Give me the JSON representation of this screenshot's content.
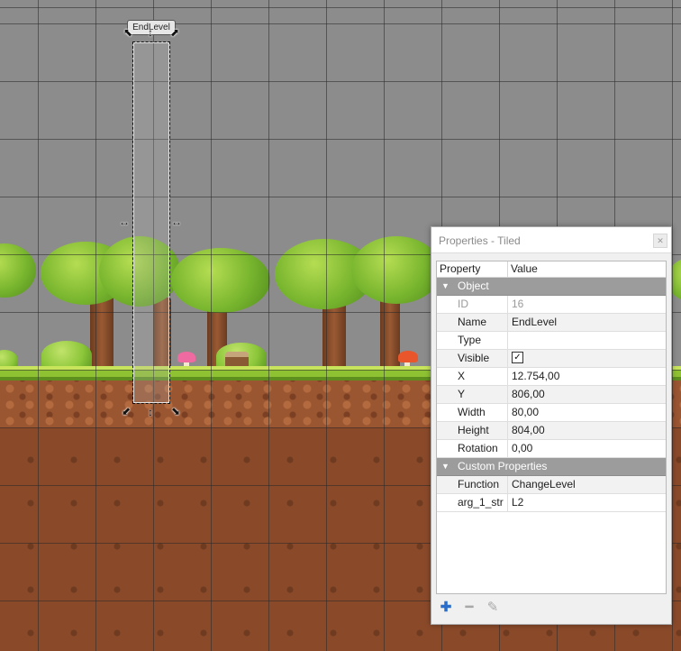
{
  "map": {
    "object_label": "EndLevel",
    "colors": {
      "background": "#8c8c8c",
      "dirt": "#8a4a2a",
      "grass": "#8fc232"
    }
  },
  "panel": {
    "title": "Properties - Tiled",
    "close_icon": "close-icon",
    "headers": {
      "property": "Property",
      "value": "Value"
    },
    "object_group": "Object",
    "object_rows": [
      {
        "key": "ID",
        "value": "16"
      },
      {
        "key": "Name",
        "value": "EndLevel"
      },
      {
        "key": "Type",
        "value": ""
      },
      {
        "key": "Visible",
        "value": "✓"
      },
      {
        "key": "X",
        "value": "12.754,00"
      },
      {
        "key": "Y",
        "value": "806,00"
      },
      {
        "key": "Width",
        "value": "80,00"
      },
      {
        "key": "Height",
        "value": "804,00"
      },
      {
        "key": "Rotation",
        "value": "0,00"
      }
    ],
    "custom_group": "Custom Properties",
    "custom_rows": [
      {
        "key": "Function",
        "value": "ChangeLevel"
      },
      {
        "key": "arg_1_str",
        "value": "L2"
      }
    ],
    "toolbar": {
      "add_icon": "plus-icon",
      "remove_icon": "minus-icon",
      "edit_icon": "pencil-icon"
    }
  }
}
